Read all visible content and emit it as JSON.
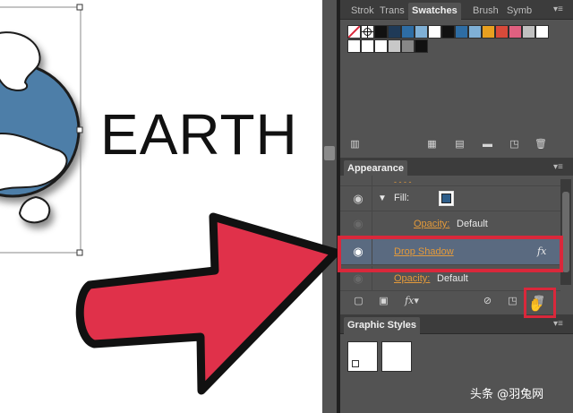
{
  "canvas": {
    "text": "EARTH"
  },
  "swatches_panel": {
    "tabs": [
      "Strok",
      "Trans",
      "Swatches",
      "Brush",
      "Symb"
    ],
    "active_tab": "Swatches",
    "menu": "▾≡",
    "swatch_colors_row1": [
      "#ffffff",
      "#ffffff",
      "#111111",
      "#1f3a57",
      "#2e6da4",
      "#7fb0d6",
      "#ffffff",
      "#111111",
      "#2e6da4",
      "#7fb0d6",
      "#e8a020",
      "#d84a3a",
      "#e06080",
      "#c0c0c0",
      "#ffffff"
    ],
    "swatch_colors_row2": [
      "#ffffff",
      "#ffffff",
      "#ffffff",
      "#c8c8c8",
      "#888888",
      "#111111"
    ]
  },
  "appearance_panel": {
    "title": "Appearance",
    "menu": "▾≡",
    "fill_label": "Fill:",
    "opacity_label": "Opacity:",
    "opacity_value": "Default",
    "drop_shadow_label": "Drop Shadow",
    "fx_label": "fx",
    "opacity2_label": "Opacity:",
    "opacity2_value": "Default"
  },
  "graphic_styles_panel": {
    "title": "Graphic Styles",
    "menu": "▾≡"
  },
  "colors": {
    "highlight": "#d9283b",
    "arrow_fill": "#e0314a",
    "earth_blue": "#4d7ea8",
    "orange": "#e39a3b",
    "selected_row": "#5a6a80"
  },
  "watermark": "头条 @羽兔网"
}
